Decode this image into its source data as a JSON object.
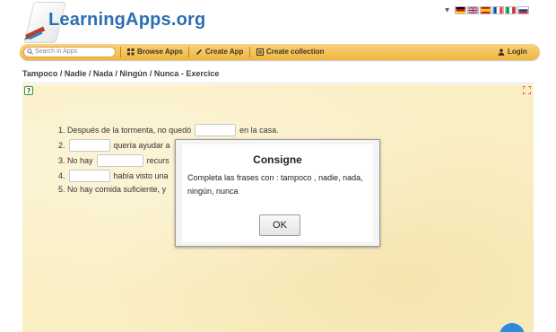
{
  "header": {
    "logo_text": "LearningApps.org"
  },
  "languages": [
    "de",
    "en",
    "es",
    "fr",
    "it",
    "ru"
  ],
  "toolbar": {
    "search_placeholder": "Search in Apps",
    "browse_label": "Browse Apps",
    "create_label": "Create App",
    "collection_label": "Create collection",
    "login_label": "Login"
  },
  "page": {
    "title": "Tampoco / Nadie / Nada / Ningún / Nunca - Exercice"
  },
  "exercise": {
    "lines": [
      {
        "num": "1.",
        "before": "Después de la tormenta, no quedó",
        "after": "en la casa."
      },
      {
        "num": "2.",
        "before": "",
        "after": "quería ayudar a"
      },
      {
        "num": "3.",
        "before": "No hay",
        "after": "recurs"
      },
      {
        "num": "4.",
        "before": "",
        "after": "había visto una"
      },
      {
        "num": "5.",
        "before": "No hay comida suficiente, y",
        "after": ""
      }
    ]
  },
  "modal": {
    "title": "Consigne",
    "message": "Completa las frases con : tampoco , nadie, nada, ningún, nunca",
    "ok_label": "OK"
  },
  "colors": {
    "brand_blue": "#2a6eb4",
    "toolbar_orange": "#f0b63e",
    "stage_bg": "#faeec3",
    "fab_blue": "#2e8ad6"
  }
}
